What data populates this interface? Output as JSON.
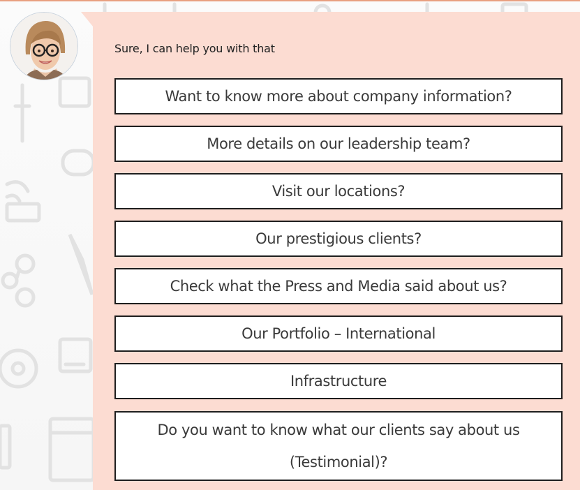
{
  "chat": {
    "agent_avatar": "agent-avatar",
    "greeting": "Sure, I can help you with that",
    "options": [
      "Want to know more about company information?",
      "More details on our leadership team?",
      "Visit our locations?",
      "Our prestigious clients?",
      "Check what the Press and Media said about us?",
      "Our Portfolio – International",
      "Infrastructure",
      "Do you want to know what our clients say about us (Testimonial)?"
    ]
  },
  "colors": {
    "bubble": "#fcdcd2",
    "option_border": "#1e1e1e",
    "top_rule": "#e8a080"
  }
}
